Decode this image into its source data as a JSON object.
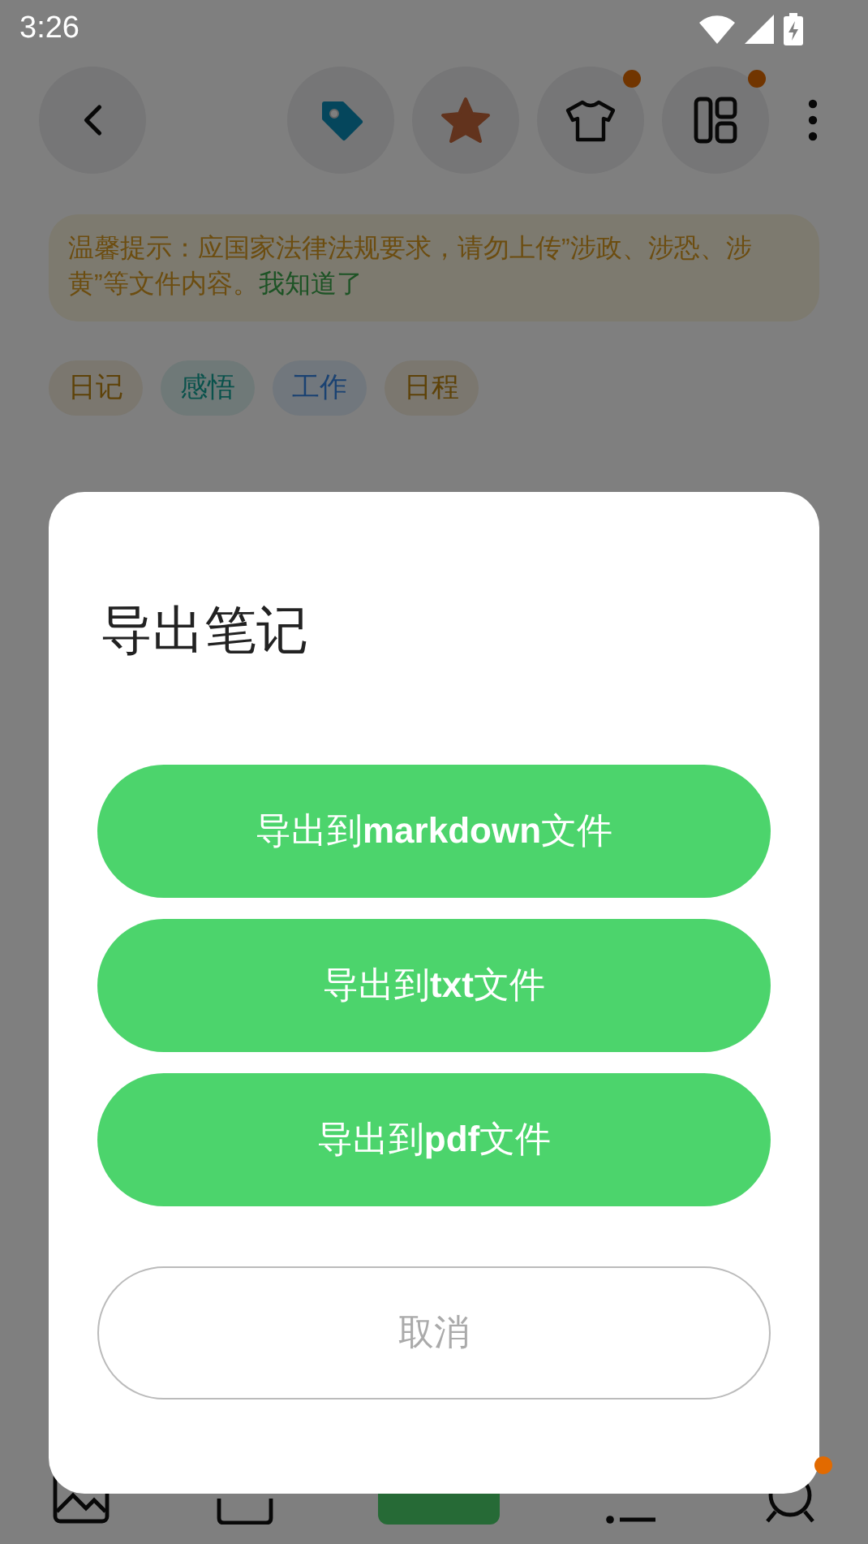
{
  "status_bar": {
    "time": "3:26"
  },
  "toolbar": {
    "buttons": [
      {
        "kind": "back",
        "badge": false
      },
      {
        "kind": "tag",
        "badge": false
      },
      {
        "kind": "star",
        "badge": false
      },
      {
        "kind": "shirt",
        "badge": true
      },
      {
        "kind": "layout",
        "badge": true
      },
      {
        "kind": "more",
        "badge": false
      }
    ]
  },
  "notice": {
    "text": "温馨提示：应国家法律法规要求，请勿上传”涉政、涉恐、涉黄”等文件内容。",
    "link": "我知道了"
  },
  "tags": [
    {
      "label": "日记",
      "color": "#5e4208"
    },
    {
      "label": "感悟",
      "color": "#0a524c"
    },
    {
      "label": "工作",
      "color": "#1a4272"
    },
    {
      "label": "日程",
      "color": "#5e4208"
    }
  ],
  "dialog": {
    "title": "导出笔记",
    "buttons": [
      {
        "label": "导出到**markdown**文件"
      },
      {
        "label": "导出到**txt**文件"
      },
      {
        "label": "导出到**pdf**文件"
      }
    ],
    "cancel": "取消"
  },
  "bottom_bar": {
    "items": [
      {
        "kind": "image",
        "badge": false
      },
      {
        "kind": "box",
        "badge": false
      },
      {
        "kind": "add",
        "badge": false
      },
      {
        "kind": "list",
        "badge": false
      },
      {
        "kind": "search",
        "badge": true
      }
    ]
  }
}
